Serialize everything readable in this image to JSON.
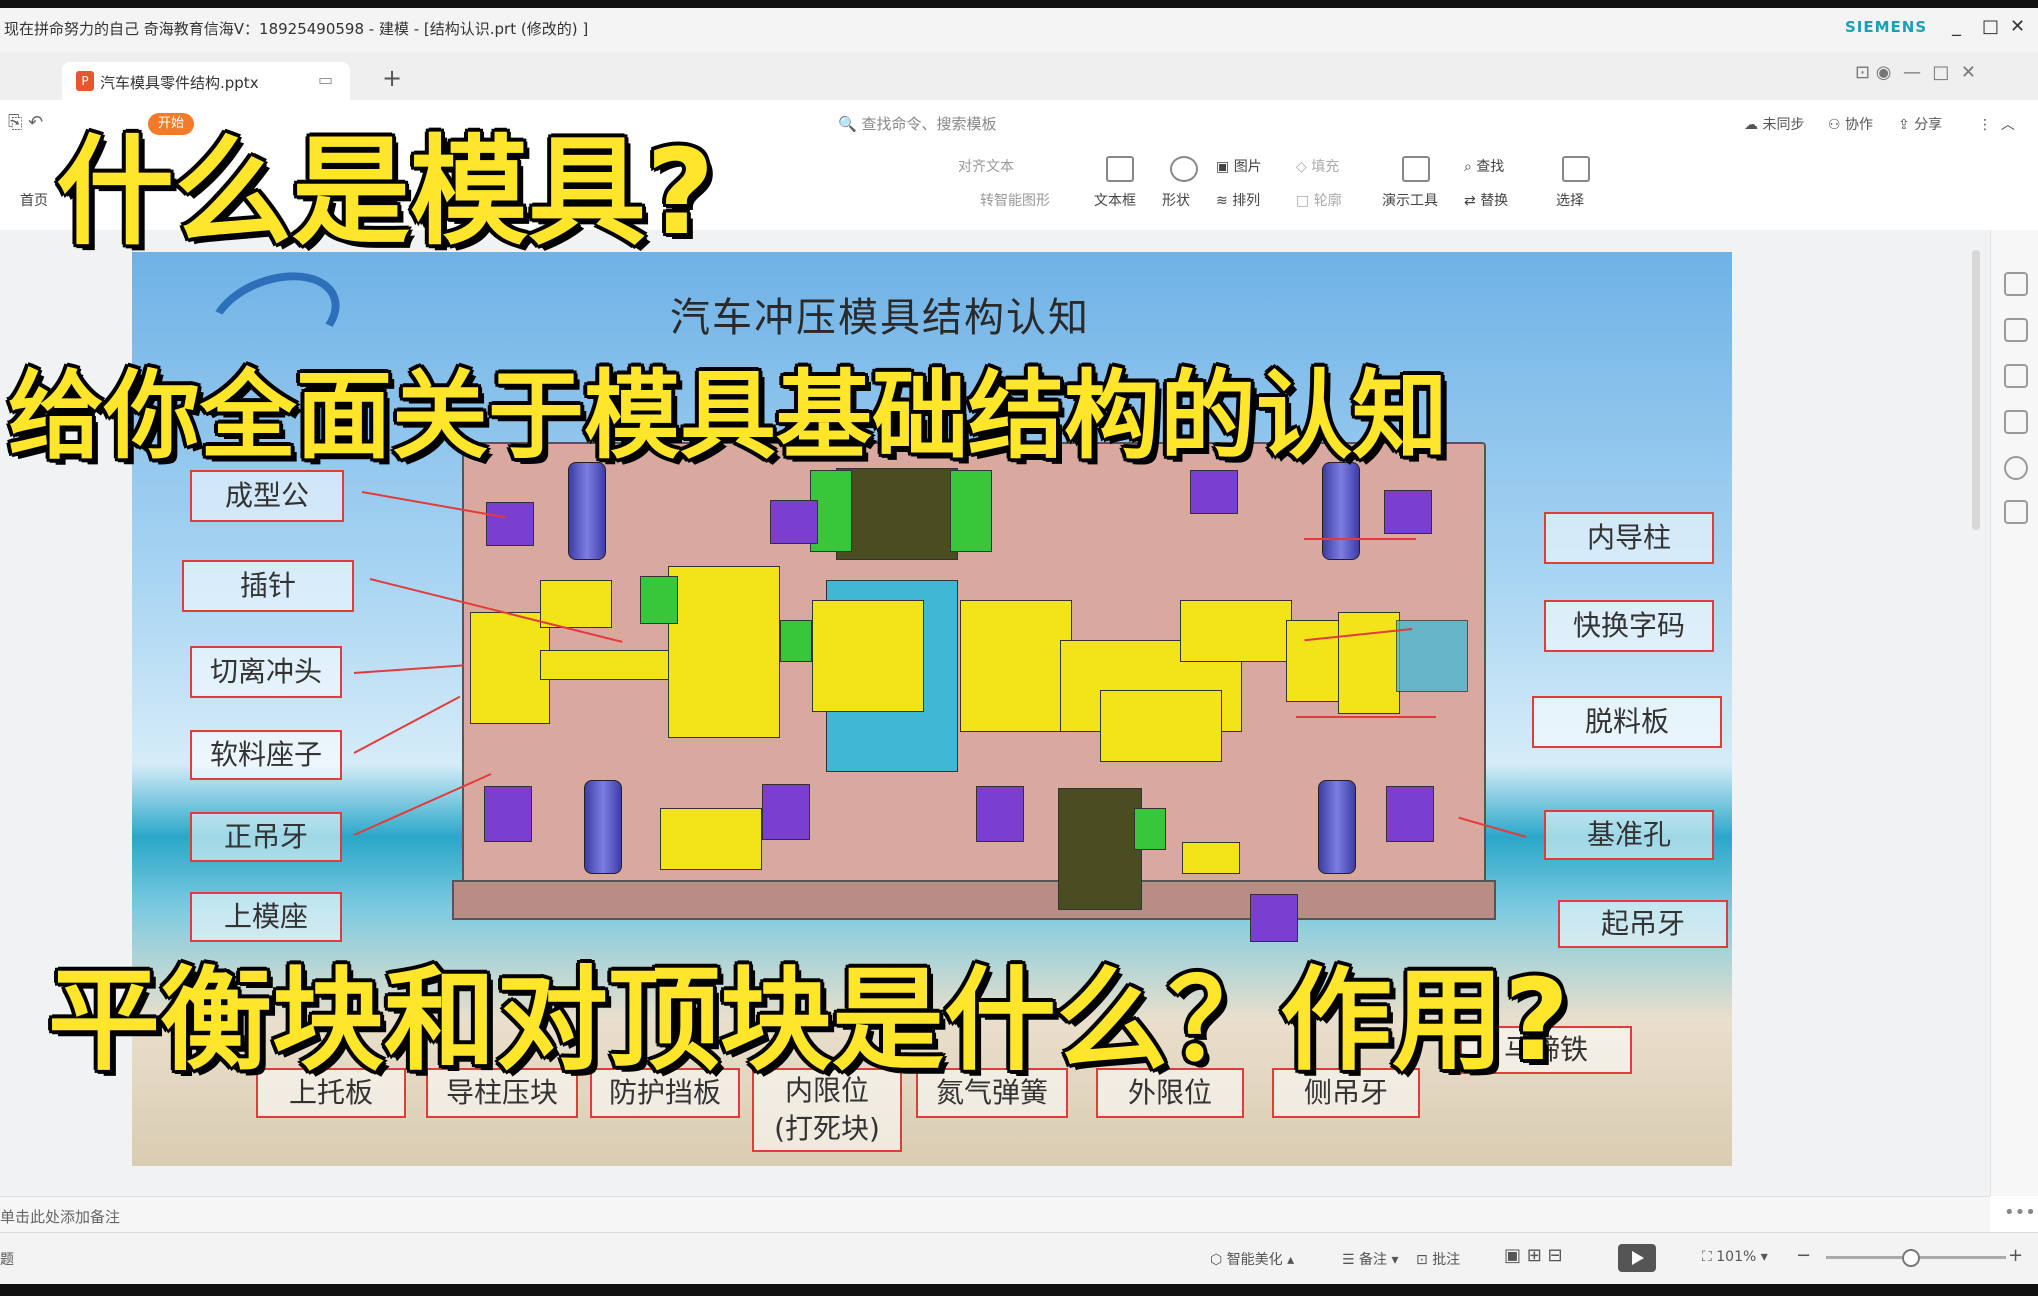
{
  "window": {
    "title": "现在拼命努力的自己  奇海教育信海V：18925490598 - 建模 - [结构认识.prt  (修改的)  ]",
    "brand": "SIEMENS",
    "minimize": "_",
    "maximize": "□",
    "close": "✕"
  },
  "tabbar": {
    "doc_tab_label": "汽车模具零件结构.pptx",
    "doc_tab_icon": "P",
    "new_tab": "+"
  },
  "ribbon": {
    "start_badge": "开始",
    "search_placeholder": "查找命令、搜索模板",
    "sync": "未同步",
    "collab": "协作",
    "share": "分享",
    "items": {
      "first_page": "首页",
      "align_text": "对齐文本",
      "smart_art": "转智能图形",
      "textbox": "文本框",
      "shape": "形状",
      "image": "图片",
      "fill": "填充",
      "arrange": "排列",
      "outline": "轮廓",
      "present_tools": "演示工具",
      "find": "查找",
      "replace": "替换",
      "select": "选择"
    }
  },
  "slide": {
    "title": "汽车冲压模具结构认知",
    "left_labels": [
      "成型公",
      "插针",
      "切离冲头",
      "软料座子",
      "正吊牙",
      "上模座"
    ],
    "right_labels": [
      "内导柱",
      "快换字码",
      "脱料板",
      "基准孔",
      "起吊牙",
      "马蹄铁"
    ],
    "bottom_labels": [
      "上托板",
      "导柱压块",
      "防护挡板",
      "内限位\n(打死块)",
      "氮气弹簧",
      "外限位",
      "侧吊牙"
    ]
  },
  "captions": {
    "line1": "什么是模具?",
    "line2": "给你全面关于模具基础结构的认知",
    "line3": "平衡块和对顶块是什么？作用?"
  },
  "notes": {
    "placeholder": "单击此处添加备注"
  },
  "statusbar": {
    "left": "题",
    "smart_beautify": "智能美化",
    "notes_toggle": "备注",
    "comments": "批注",
    "zoom": "101%",
    "zoom_minus": "−",
    "zoom_plus": "+"
  },
  "colors": {
    "caption_fill": "#ffe62a",
    "label_border": "#e23b3b",
    "start_badge": "#f47a2a",
    "brand": "#1aa0b8"
  }
}
